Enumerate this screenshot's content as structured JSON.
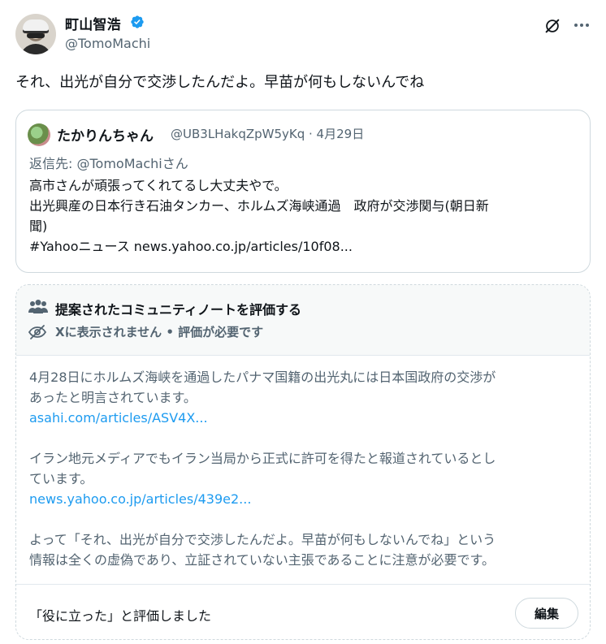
{
  "author": {
    "name": "町山智浩",
    "handle": "@TomoMachi",
    "verified_color": "#1d9bf0"
  },
  "tweet": {
    "text": "それ、出光が自分で交渉したんだよ。早苗が何もしないんでね"
  },
  "quoted": {
    "name": "たかりんちゃん",
    "handle_date": "@UB3LHakqZpW5yKq · 4月29日",
    "reply_prefix": "返信先: ",
    "reply_to": "@TomoMachiさん",
    "lines": [
      "高市さんが頑張ってくれてるし大丈夫やで。",
      "出光興産の日本行き石油タンカー、ホルムズ海峡通過　政府が交渉関与(朝日新",
      "聞)",
      "#Yahooニュース news.yahoo.co.jp/articles/10f08..."
    ]
  },
  "community_note": {
    "title": "提案されたコミュニティノートを評価する",
    "status": "Xに表示されません • 評価が必要です",
    "para1_lines": [
      "4月28日にホルムズ海峡を通過したパナマ国籍の出光丸には日本国政府の交渉が",
      "あったと明言されています。"
    ],
    "link1": "asahi.com/articles/ASV4X...",
    "para2_lines": [
      "イラン地元メディアでもイラン当局から正式に許可を得たと報道されているとし",
      "ています。"
    ],
    "link2": "news.yahoo.co.jp/articles/439e2...",
    "para3_lines": [
      "よって「それ、出光が自分で交渉したんだよ。早苗が何もしないんでね」という",
      "情報は全くの虚偽であり、立証されていない主張であることに注意が必要です。"
    ],
    "rated_text": "「役に立った」と評価しました",
    "edit_label": "編集"
  },
  "icons": {
    "verified": "verified-badge-icon",
    "grok": "grok-icon",
    "more": "more-icon",
    "people": "people-icon",
    "eye_off": "eye-off-icon"
  },
  "colors": {
    "link": "#1d9bf0",
    "secondary_text": "#536471",
    "note_header_bg": "#f7f9f9"
  }
}
